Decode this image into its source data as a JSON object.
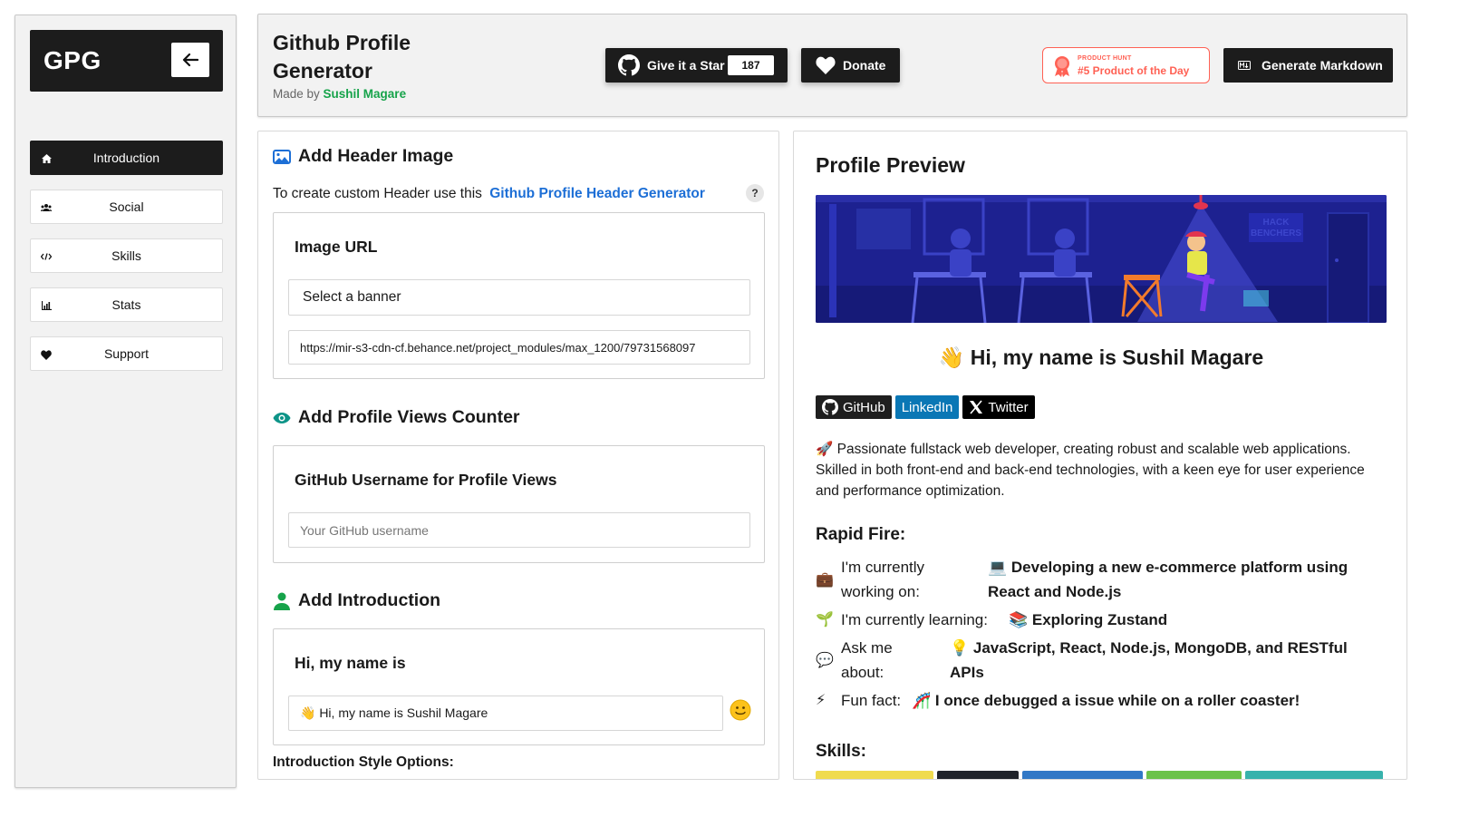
{
  "sidebar": {
    "logo": "GPG",
    "items": [
      {
        "label": "Introduction",
        "icon": "home-icon",
        "active": true
      },
      {
        "label": "Social",
        "icon": "users-icon",
        "active": false
      },
      {
        "label": "Skills",
        "icon": "code-icon",
        "active": false
      },
      {
        "label": "Stats",
        "icon": "chart-icon",
        "active": false
      },
      {
        "label": "Support",
        "icon": "heart-icon",
        "active": false
      }
    ]
  },
  "header": {
    "title": "Github Profile Generator",
    "made_by_prefix": "Made by",
    "author": "Sushil Magare",
    "star_label": "Give it a Star",
    "star_count": "187",
    "donate_label": "Donate",
    "product_hunt_small": "PRODUCT HUNT",
    "product_hunt_big": "#5 Product of the Day",
    "generate_label": "Generate Markdown"
  },
  "form": {
    "header_image": {
      "title": "Add Header Image",
      "helper_text": "To create custom Header use this",
      "helper_link": "Github Profile Header Generator",
      "help_mark": "?",
      "card_label": "Image URL",
      "select_value": "Select a banner",
      "url_value": "https://mir-s3-cdn-cf.behance.net/project_modules/max_1200/79731568097"
    },
    "views_counter": {
      "title": "Add Profile Views Counter",
      "card_label": "GitHub Username for Profile Views",
      "placeholder": "Your GitHub username"
    },
    "introduction": {
      "title": "Add Introduction",
      "card_label": "Hi, my name is",
      "value": "👋 Hi, my name is Sushil Magare",
      "style_options_label": "Introduction Style Options:"
    }
  },
  "preview": {
    "title": "Profile Preview",
    "banner_text": "HACK BENCHERS",
    "greeting": "👋 Hi, my name is Sushil Magare",
    "socials": [
      {
        "label": "GitHub",
        "color": "#1f1f1f"
      },
      {
        "label": "LinkedIn",
        "color": "#0a77b5"
      },
      {
        "label": "Twitter",
        "color": "#000000"
      }
    ],
    "bio": "🚀 Passionate fullstack web developer, creating robust and scalable web applications. Skilled in both front-end and back-end technologies, with a keen eye for user experience and performance optimization.",
    "rapid_fire_title": "Rapid Fire:",
    "rapid_fire": [
      {
        "icon": "💼",
        "label": "I'm currently working on:",
        "value": "💻 Developing a new e-commerce platform using React and Node.js"
      },
      {
        "icon": "🌱",
        "label": "I'm currently learning:",
        "value": "📚 Exploring Zustand"
      },
      {
        "icon": "💬",
        "label": "Ask me about:",
        "value": "💡 JavaScript, React, Node.js, MongoDB, and RESTful APIs"
      },
      {
        "icon": "⚡",
        "label": "Fun fact:",
        "value": "🎢 I once debugged a issue while on a roller coaster!"
      }
    ],
    "skills_title": "Skills:",
    "skill_colors": [
      "#f0db4f",
      "#20232a",
      "#3178c6",
      "#6cc24a",
      "#38b2ac"
    ]
  },
  "colors": {
    "dark": "#1c1c1c",
    "link_blue": "#1d6fd6",
    "author_green": "#16a34a",
    "product_hunt": "#ff6154"
  }
}
